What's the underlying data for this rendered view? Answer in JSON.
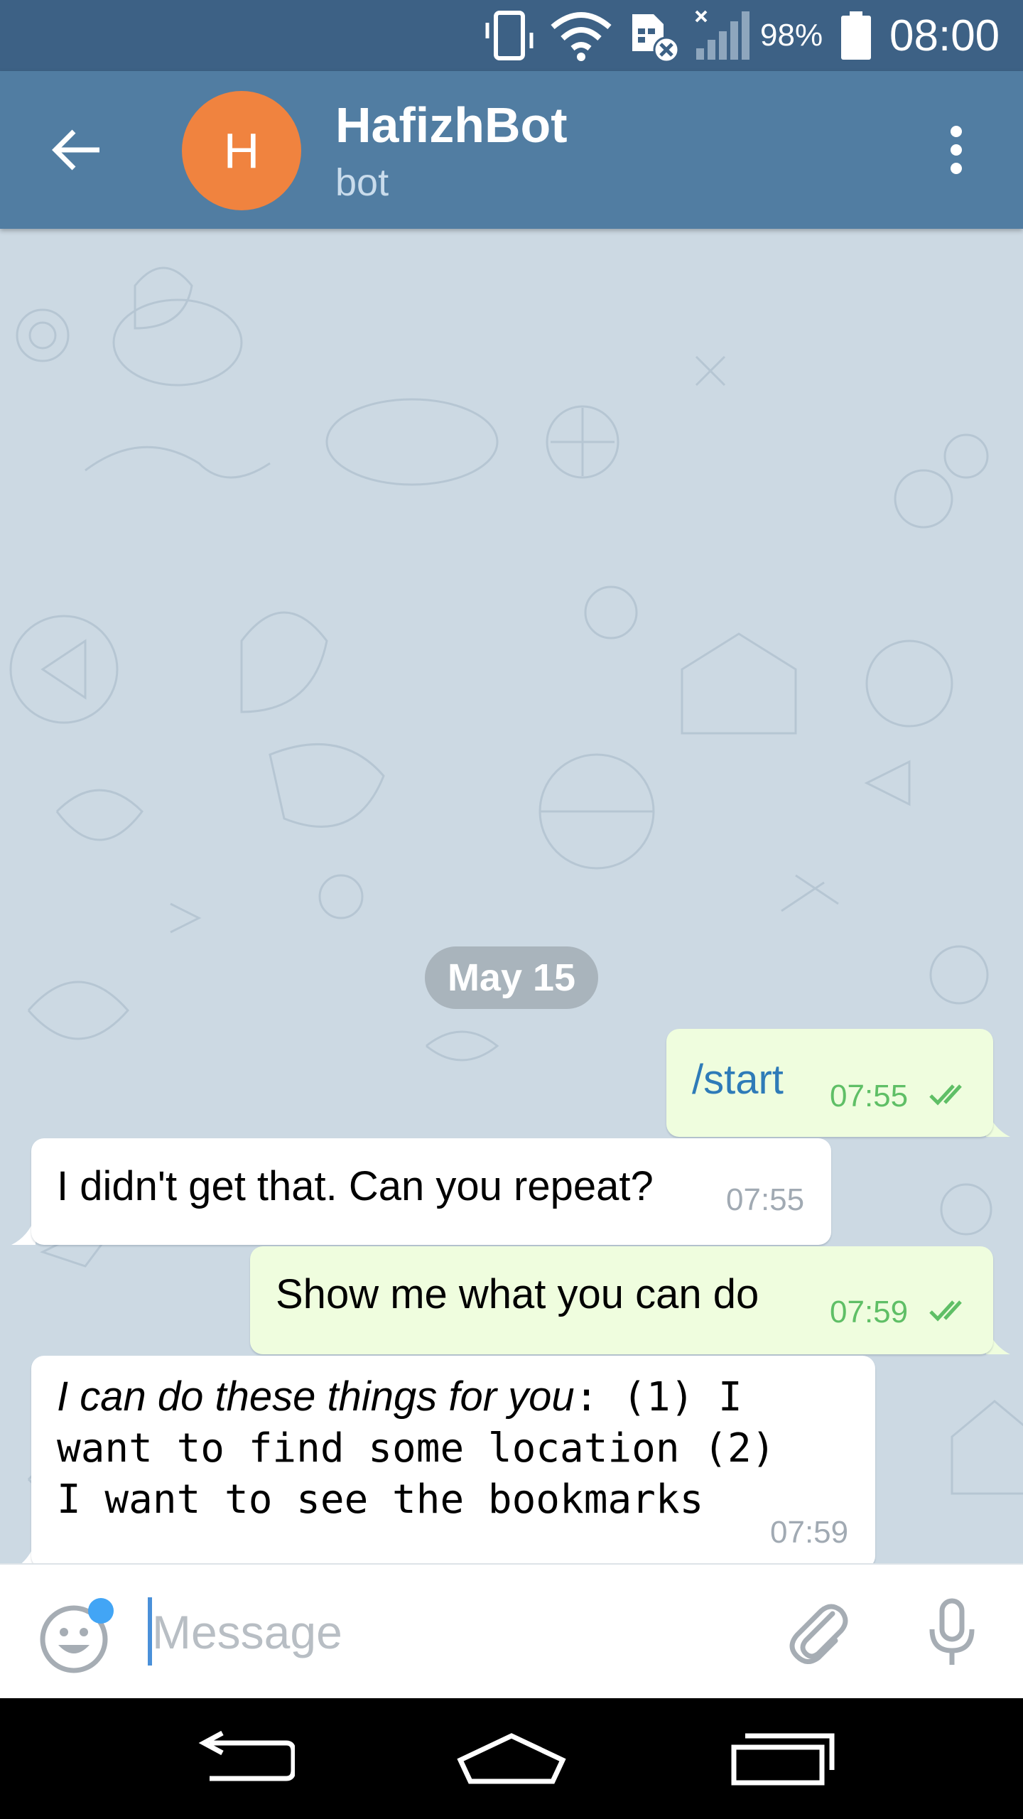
{
  "status_bar": {
    "battery_percent": "98%",
    "time": "08:00",
    "icons": [
      "vibrate-icon",
      "wifi-icon",
      "sim-missing-icon",
      "signal-icon",
      "battery-icon"
    ]
  },
  "header": {
    "avatar_letter": "H",
    "avatar_color": "#f0833f",
    "title": "HafizhBot",
    "subtitle": "bot"
  },
  "chat": {
    "date_label": "May 15",
    "messages": [
      {
        "direction": "out",
        "text": "/start",
        "time": "07:55",
        "status": "read"
      },
      {
        "direction": "in",
        "text": "I didn't get that. Can you repeat?",
        "time": "07:55"
      },
      {
        "direction": "out",
        "text": "Show me what you can do",
        "time": "07:59",
        "status": "read"
      },
      {
        "direction": "in",
        "italic_part": "I can do these things for you",
        "line1_rest": ": (1) I",
        "line2": "want to find some location (2)",
        "line3": "I want to see the bookmarks",
        "time": "07:59"
      }
    ]
  },
  "input": {
    "placeholder": "Message",
    "value": ""
  },
  "colors": {
    "header_bg": "#517da2",
    "status_bg": "#3d6185",
    "outgoing_bubble": "#effdde",
    "incoming_bubble": "#ffffff",
    "chat_bg": "#ccd9e3",
    "read_check": "#5fbf66"
  }
}
